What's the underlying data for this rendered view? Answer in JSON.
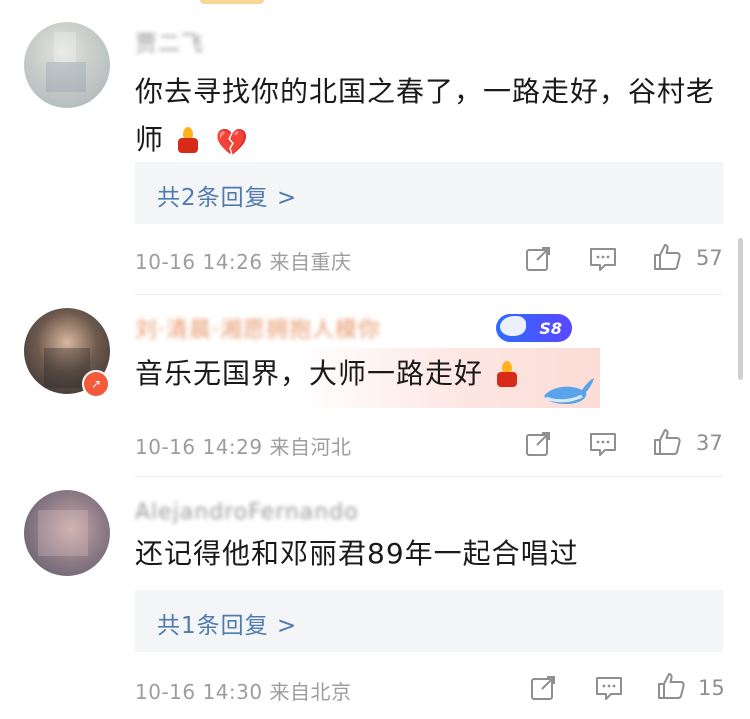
{
  "comments": [
    {
      "username": "贾二飞",
      "text": "你去寻找你的北国之春了，一路走好，谷村老师",
      "emojis": [
        "candle-icon",
        "broken-heart-icon"
      ],
      "reply_label": "共2条回复 >",
      "meta": "10-16 14:26 来自重庆",
      "likes": "57"
    },
    {
      "username": "刘·清晨·湘愿拥抱人模你",
      "badge": "S8",
      "text": "音乐无国界，大师一路走好",
      "emojis": [
        "candle-icon"
      ],
      "meta": "10-16 14:29 来自河北",
      "likes": "37"
    },
    {
      "username": "AlejandroFernando",
      "text": "还记得他和邓丽君89年一起合唱过",
      "reply_label": "共1条回复 >",
      "meta": "10-16 14:30 来自北京",
      "likes": "15"
    }
  ],
  "colors": {
    "reply_link": "#4f7bb0",
    "meta_gray": "#9d9d9d",
    "reply_bg": "#f4f5f7",
    "vip_badge": "#3d5cff"
  }
}
